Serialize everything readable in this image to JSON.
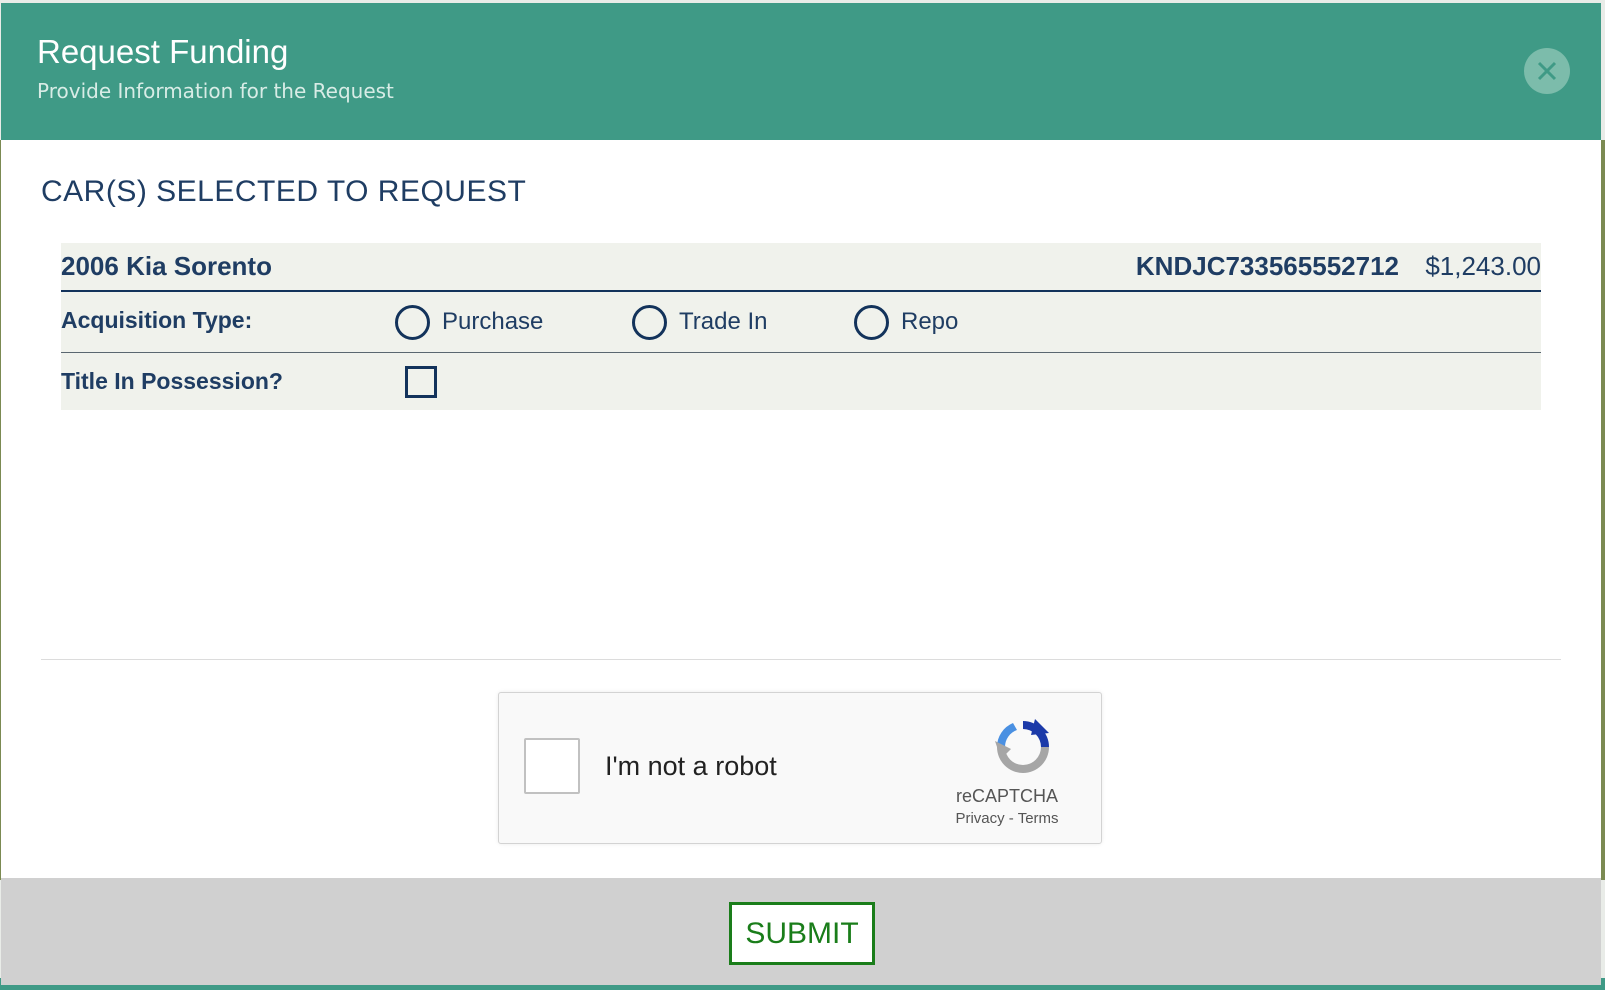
{
  "modal": {
    "title": "Request Funding",
    "subtitle": "Provide Information for the Request",
    "close_icon": "close-icon"
  },
  "section_title": "CAR(S) SELECTED TO REQUEST",
  "car": {
    "name": "2006 Kia Sorento",
    "vin": "KNDJC733565552712",
    "price": "$1,243.00",
    "acquisition_label": "Acquisition Type:",
    "acquisition_options": [
      {
        "label": "Purchase",
        "selected": false
      },
      {
        "label": "Trade In",
        "selected": false
      },
      {
        "label": "Repo",
        "selected": false
      }
    ],
    "title_label": "Title In Possession?",
    "title_checked": false
  },
  "recaptcha": {
    "label": "I'm not a robot",
    "brand": "reCAPTCHA",
    "privacy": "Privacy",
    "separator": " - ",
    "terms": "Terms",
    "icon": "recaptcha-logo-icon"
  },
  "footer": {
    "submit_label": "SUBMIT"
  },
  "colors": {
    "header": "#3f9a86",
    "navy": "#1f3d63",
    "card_bg": "#f0f2ec",
    "submit_green": "#1a7d1a",
    "footer_bg": "#d0d0d0"
  }
}
